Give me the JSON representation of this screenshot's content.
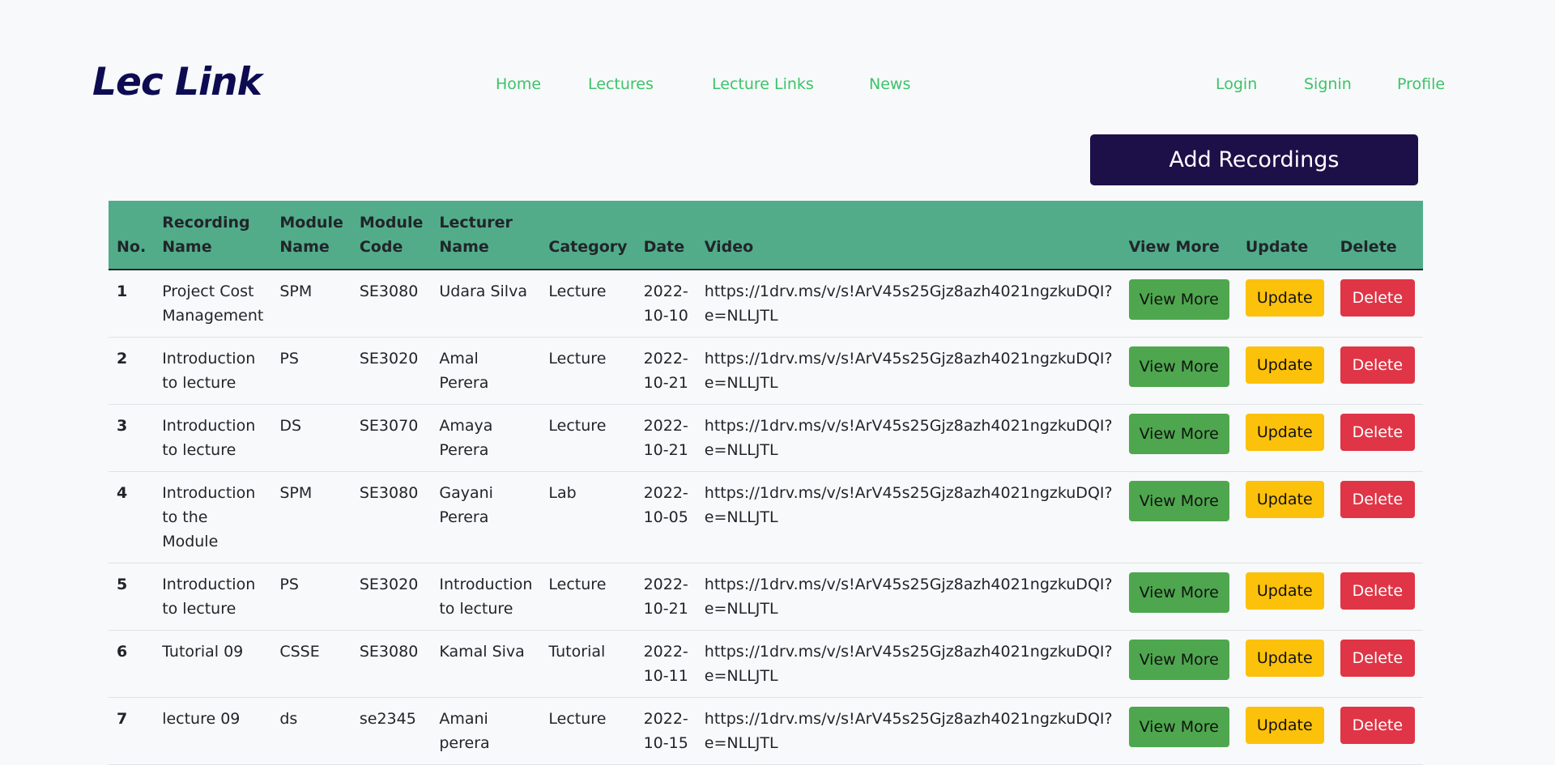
{
  "brand": "Lec Link",
  "nav": {
    "home": "Home",
    "lectures": "Lectures",
    "lecture_links": "Lecture Links",
    "news": "News",
    "login": "Login",
    "signin": "Signin",
    "profile": "Profile"
  },
  "add_button": "Add Recordings",
  "table": {
    "headers": {
      "no": "No.",
      "recording_name": "Recording Name",
      "module_name": "Module Name",
      "module_code": "Module Code",
      "lecturer_name": "Lecturer Name",
      "category": "Category",
      "date": "Date",
      "video": "Video",
      "view_more": "View More",
      "update": "Update",
      "delete": "Delete"
    },
    "actions": {
      "view_more": "View More",
      "update": "Update",
      "delete": "Delete"
    },
    "rows": [
      {
        "no": "1",
        "name": "Project Cost Management",
        "module": "SPM",
        "code": "SE3080",
        "lecturer": "Udara Silva",
        "category": "Lecture",
        "date": "2022-10-10",
        "video": "https://1drv.ms/v/s!ArV45s25Gjz8azh4021ngzkuDQI?e=NLLJTL"
      },
      {
        "no": "2",
        "name": "Introduction to lecture",
        "module": "PS",
        "code": "SE3020",
        "lecturer": "Amal Perera",
        "category": "Lecture",
        "date": "2022-10-21",
        "video": "https://1drv.ms/v/s!ArV45s25Gjz8azh4021ngzkuDQI?e=NLLJTL"
      },
      {
        "no": "3",
        "name": "Introduction to lecture",
        "module": "DS",
        "code": "SE3070",
        "lecturer": "Amaya Perera",
        "category": "Lecture",
        "date": "2022-10-21",
        "video": "https://1drv.ms/v/s!ArV45s25Gjz8azh4021ngzkuDQI?e=NLLJTL"
      },
      {
        "no": "4",
        "name": "Introduction to the Module",
        "module": "SPM",
        "code": "SE3080",
        "lecturer": "Gayani Perera",
        "category": "Lab",
        "date": "2022-10-05",
        "video": "https://1drv.ms/v/s!ArV45s25Gjz8azh4021ngzkuDQI?e=NLLJTL"
      },
      {
        "no": "5",
        "name": "Introduction to lecture",
        "module": "PS",
        "code": "SE3020",
        "lecturer": "Introduction to lecture",
        "category": "Lecture",
        "date": "2022-10-21",
        "video": "https://1drv.ms/v/s!ArV45s25Gjz8azh4021ngzkuDQI?e=NLLJTL"
      },
      {
        "no": "6",
        "name": "Tutorial 09",
        "module": "CSSE",
        "code": "SE3080",
        "lecturer": "Kamal Siva",
        "category": "Tutorial",
        "date": "2022-10-11",
        "video": "https://1drv.ms/v/s!ArV45s25Gjz8azh4021ngzkuDQI?e=NLLJTL"
      },
      {
        "no": "7",
        "name": "lecture 09",
        "module": "ds",
        "code": "se2345",
        "lecturer": "Amani perera",
        "category": "Lecture",
        "date": "2022-10-15",
        "video": "https://1drv.ms/v/s!ArV45s25Gjz8azh4021ngzkuDQI?e=NLLJTL"
      }
    ]
  },
  "colors": {
    "brand": "#0d0c52",
    "nav_link": "#3cc36a",
    "add_button_bg": "#1d1049",
    "table_header_bg": "#52ac8a",
    "view_more": "#4ea74e",
    "update": "#fcc10a",
    "delete": "#df3546"
  }
}
